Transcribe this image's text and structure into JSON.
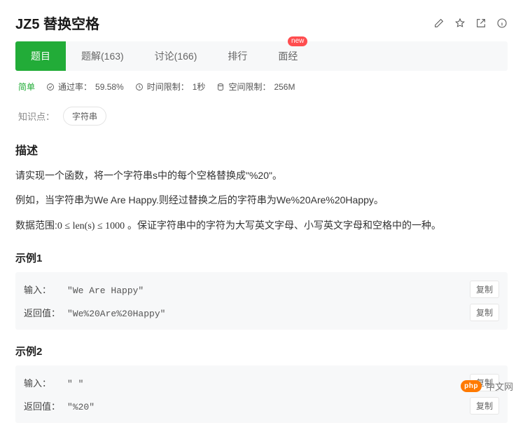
{
  "header": {
    "title": "JZ5  替换空格",
    "icons": [
      "edit-icon",
      "star-icon",
      "open-icon",
      "info-icon"
    ]
  },
  "tabs": {
    "items": [
      {
        "label": "题目",
        "active": true
      },
      {
        "label": "题解(163)"
      },
      {
        "label": "讨论(166)"
      },
      {
        "label": "排行"
      },
      {
        "label": "面经",
        "badge": "new"
      }
    ]
  },
  "meta": {
    "difficulty": "简单",
    "pass_label": "通过率：",
    "pass_value": "59.58%",
    "time_label": "时间限制：",
    "time_value": "1秒",
    "mem_label": "空间限制：",
    "mem_value": "256M"
  },
  "knowledge": {
    "label": "知识点：",
    "tags": [
      "字符串"
    ]
  },
  "description": {
    "heading": "描述",
    "line1": "请实现一个函数，将一个字符串s中的每个空格替换成\"%20\"。",
    "line2": "例如，当字符串为We Are Happy.则经过替换之后的字符串为We%20Are%20Happy。",
    "range_prefix": "数据范围:",
    "range_formula": "0 ≤ len(s) ≤ 1000",
    "range_suffix": " 。保证字符串中的字符为大写英文字母、小写英文字母和空格中的一种。"
  },
  "examples": [
    {
      "title": "示例1",
      "input_label": "输入：",
      "input_value": "\"We Are Happy\"",
      "return_label": "返回值：",
      "return_value": "\"We%20Are%20Happy\"",
      "copy": "复制"
    },
    {
      "title": "示例2",
      "input_label": "输入：",
      "input_value": "\" \"",
      "return_label": "返回值：",
      "return_value": "\"%20\"",
      "copy": "复制"
    }
  ],
  "watermark": {
    "badge": "php",
    "text": "中文网"
  }
}
